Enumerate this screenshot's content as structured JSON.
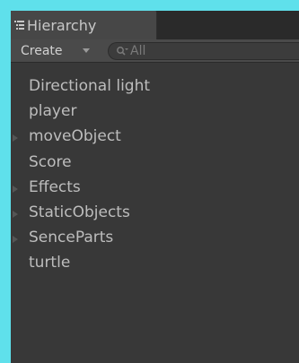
{
  "window": {
    "tab_label": "Hierarchy",
    "tab_icon": "hierarchy-list-icon"
  },
  "toolbar": {
    "create_label": "Create",
    "create_icon": "chevron-down-icon",
    "search_placeholder": "All",
    "search_value": "",
    "search_icon": "search-icon"
  },
  "hierarchy": {
    "items": [
      {
        "label": "Directional light",
        "has_children": false
      },
      {
        "label": "player",
        "has_children": false
      },
      {
        "label": "moveObject",
        "has_children": true
      },
      {
        "label": "Score",
        "has_children": false
      },
      {
        "label": "Effects",
        "has_children": true
      },
      {
        "label": "StaticObjects",
        "has_children": true
      },
      {
        "label": "SenceParts",
        "has_children": true
      },
      {
        "label": "turtle",
        "has_children": false
      }
    ]
  },
  "colors": {
    "outer_background": "#5fe0eb",
    "panel_background": "#383838",
    "toolbar_background": "#4a4a4a",
    "tab_background": "#474747",
    "text": "#bdbdbd"
  }
}
